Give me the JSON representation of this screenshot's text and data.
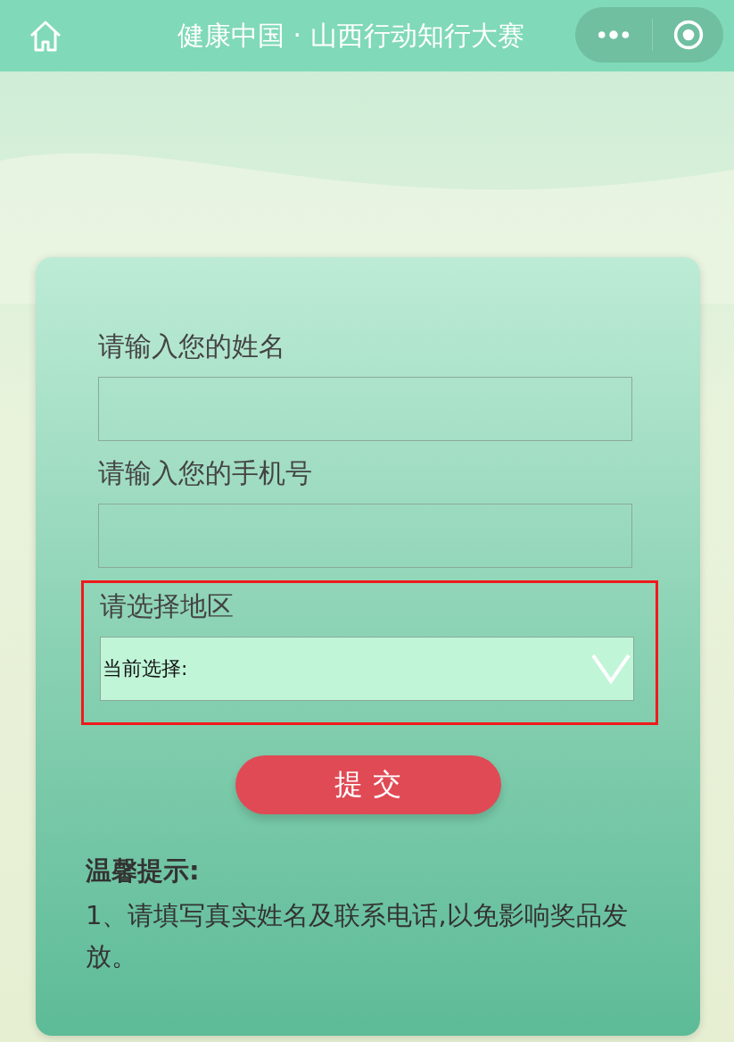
{
  "nav_bar": {
    "title": "健康中国 · 山西行动知行大赛"
  },
  "form": {
    "fields": [
      {
        "kind": "text",
        "label": "请输入您的姓名",
        "highlighted": false
      },
      {
        "kind": "text",
        "label": "请输入您的手机号",
        "highlighted": false
      },
      {
        "kind": "select",
        "label": "请选择地区",
        "value": "当前选择:",
        "highlighted": true
      }
    ],
    "submit_button": "提 交",
    "tip": {
      "title": "温馨提示:",
      "text": "1、请填写真实姓名及联系电话,以免影响奖品发放。"
    }
  }
}
